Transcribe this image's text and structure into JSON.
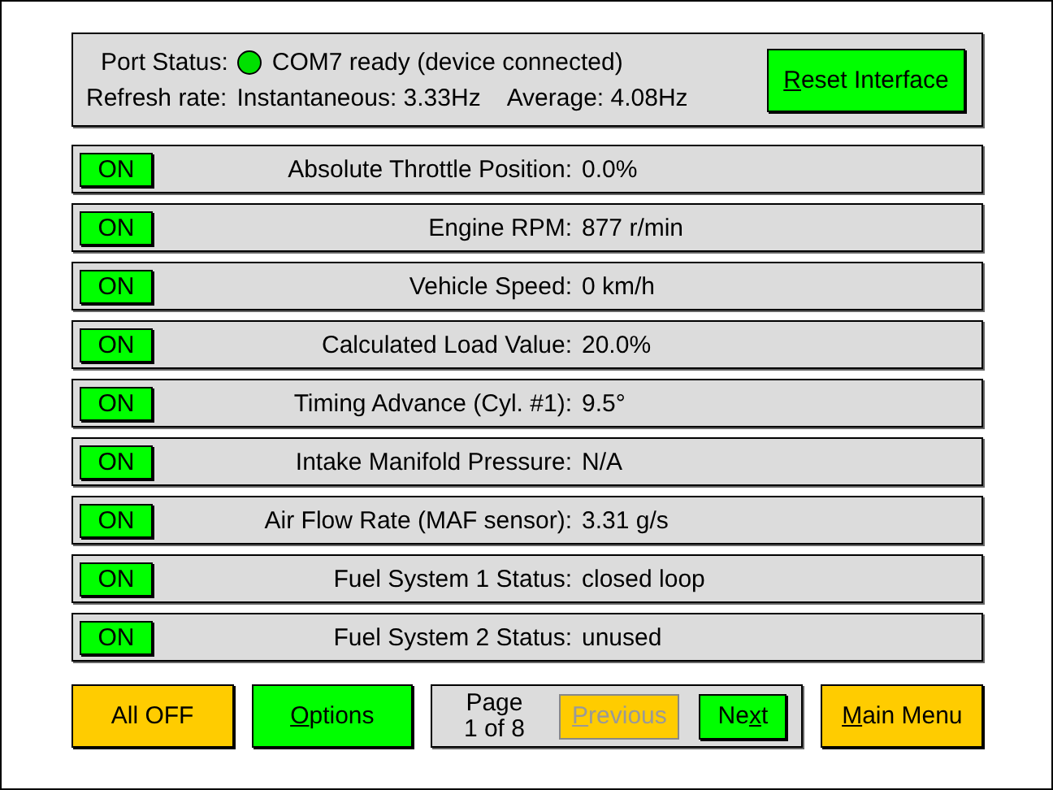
{
  "status": {
    "port_label": "Port Status:",
    "port_connected": true,
    "port_text": "COM7 ready (device connected)",
    "refresh_label": "Refresh rate:",
    "instantaneous": "Instantaneous: 3.33Hz",
    "average": "Average: 4.08Hz",
    "reset_button": {
      "key": "R",
      "after": "eset Interface"
    }
  },
  "sensors": [
    {
      "toggle": "ON",
      "on": true,
      "name": "Absolute Throttle Position:",
      "value": "0.0%"
    },
    {
      "toggle": "ON",
      "on": true,
      "name": "Engine RPM:",
      "value": "877 r/min"
    },
    {
      "toggle": "ON",
      "on": true,
      "name": "Vehicle Speed:",
      "value": "0 km/h"
    },
    {
      "toggle": "ON",
      "on": true,
      "name": "Calculated Load Value:",
      "value": "20.0%"
    },
    {
      "toggle": "ON",
      "on": true,
      "name": "Timing Advance (Cyl. #1):",
      "value": "9.5°"
    },
    {
      "toggle": "ON",
      "on": true,
      "name": "Intake Manifold Pressure:",
      "value": "N/A"
    },
    {
      "toggle": "ON",
      "on": true,
      "name": "Air Flow Rate (MAF sensor):",
      "value": "3.31 g/s"
    },
    {
      "toggle": "ON",
      "on": true,
      "name": "Fuel System 1 Status:",
      "value": "closed loop"
    },
    {
      "toggle": "ON",
      "on": true,
      "name": "Fuel System 2 Status:",
      "value": "unused"
    }
  ],
  "footer": {
    "all_off": {
      "before": "All OFF"
    },
    "options": {
      "key": "O",
      "after": "ptions"
    },
    "page_label": "Page",
    "page_count": "1 of 8",
    "previous": {
      "key": "P",
      "after": "revious"
    },
    "previous_disabled": true,
    "next": {
      "before": "Ne",
      "key": "x",
      "after": "t"
    },
    "next_disabled": false,
    "main_menu": {
      "key": "M",
      "after": "ain Menu"
    }
  }
}
